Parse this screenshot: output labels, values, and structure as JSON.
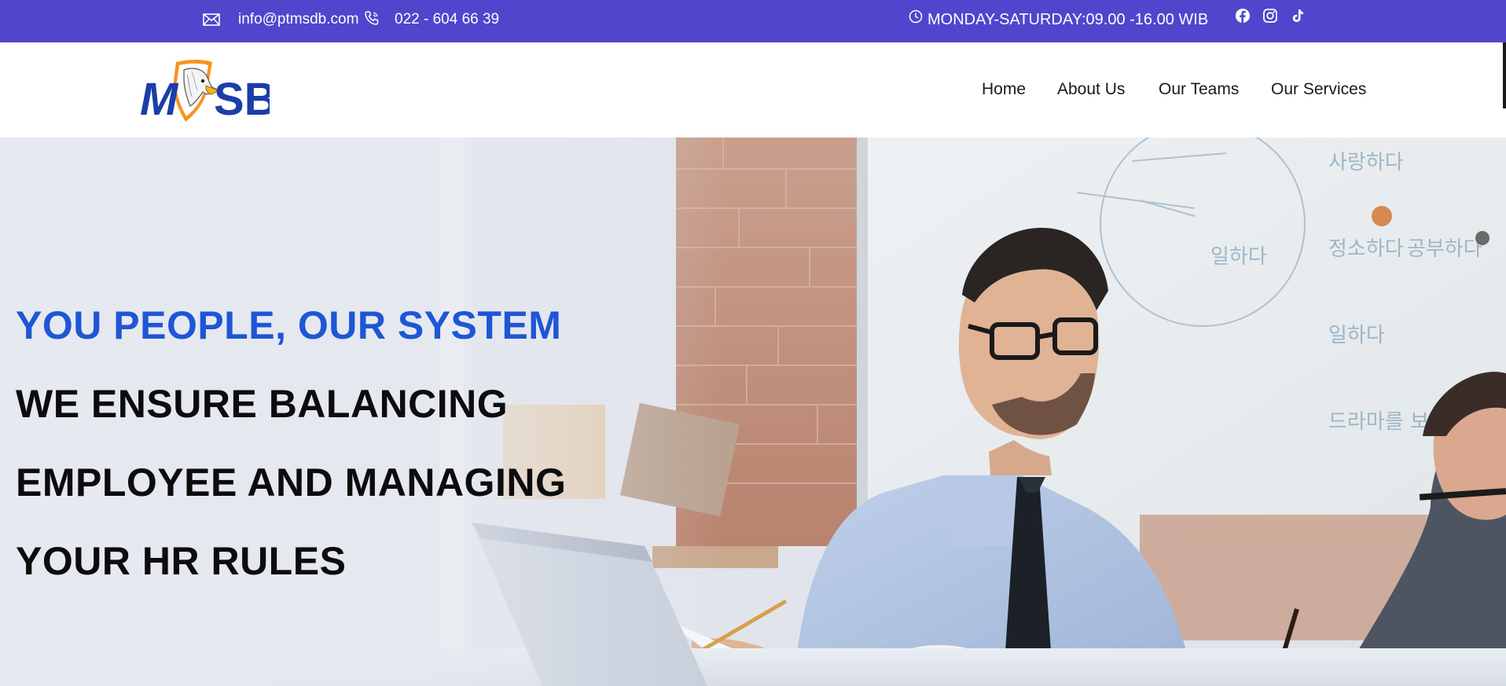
{
  "topbar": {
    "email": "info@ptmsdb.com",
    "phone": "022 - 604 66 39",
    "hours": "MONDAY-SATURDAY:09.00 -16.00 WIB",
    "icons": [
      "mail-icon",
      "phone-icon",
      "clock-icon",
      "facebook-icon",
      "instagram-icon",
      "tiktok-icon"
    ],
    "background_color": "#5145cd"
  },
  "brand": {
    "logo_text": "MSB"
  },
  "nav": {
    "items": [
      "Home",
      "About Us",
      "Our Teams",
      "Our Services"
    ]
  },
  "hero": {
    "headline_accent": "YOU PEOPLE, OUR SYSTEM",
    "lines": [
      "WE ENSURE BALANCING",
      "EMPLOYEE AND MANAGING",
      "YOUR HR RULES"
    ],
    "accent_color": "#1e56d6"
  }
}
